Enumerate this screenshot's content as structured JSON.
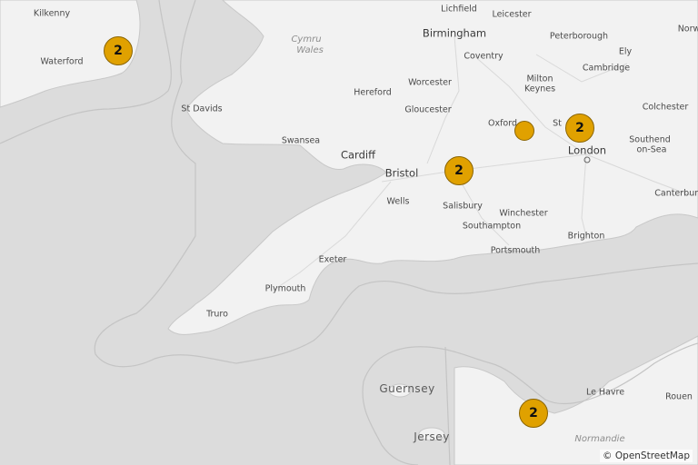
{
  "map": {
    "water_color": "#dcdcdc",
    "land_color": "#f2f2f2",
    "cluster_color": "#e0a100",
    "attribution": "© OpenStreetMap",
    "places": {
      "kilkenny": "Kilkenny",
      "waterford": "Waterford",
      "lichfield": "Lichfield",
      "leicester": "Leicester",
      "norwich": "Norw",
      "birmingham": "Birmingham",
      "peterborough": "Peterborough",
      "ely": "Ely",
      "coventry": "Coventry",
      "cymru": "Cymru",
      "wales": "Wales",
      "cambridge": "Cambridge",
      "milton_keynes_1": "Milton",
      "milton_keynes_2": "Keynes",
      "hereford": "Hereford",
      "worcester": "Worcester",
      "st_davids": "St Davids",
      "gloucester": "Gloucester",
      "colchester": "Colchester",
      "oxford": "Oxford",
      "st_albans": "St",
      "swansea": "Swansea",
      "southend_1": "Southend",
      "southend_2": "on-Sea",
      "london": "London",
      "cardiff": "Cardiff",
      "bristol": "Bristol",
      "canterbury": "Canterbury",
      "wells": "Wells",
      "salisbury": "Salisbury",
      "winchester": "Winchester",
      "southampton": "Southampton",
      "brighton": "Brighton",
      "portsmouth": "Portsmouth",
      "exeter": "Exeter",
      "plymouth": "Plymouth",
      "truro": "Truro",
      "guernsey": "Guernsey",
      "le_havre": "Le Havre",
      "rouen": "Rouen",
      "jersey": "Jersey",
      "normandie": "Normandie"
    },
    "clusters": [
      {
        "name": "cluster-waterford",
        "count": "2"
      },
      {
        "name": "cluster-london",
        "count": "2"
      },
      {
        "name": "cluster-oxford",
        "count": ""
      },
      {
        "name": "cluster-bristol-east",
        "count": "2"
      },
      {
        "name": "cluster-normandy",
        "count": "2"
      }
    ]
  }
}
